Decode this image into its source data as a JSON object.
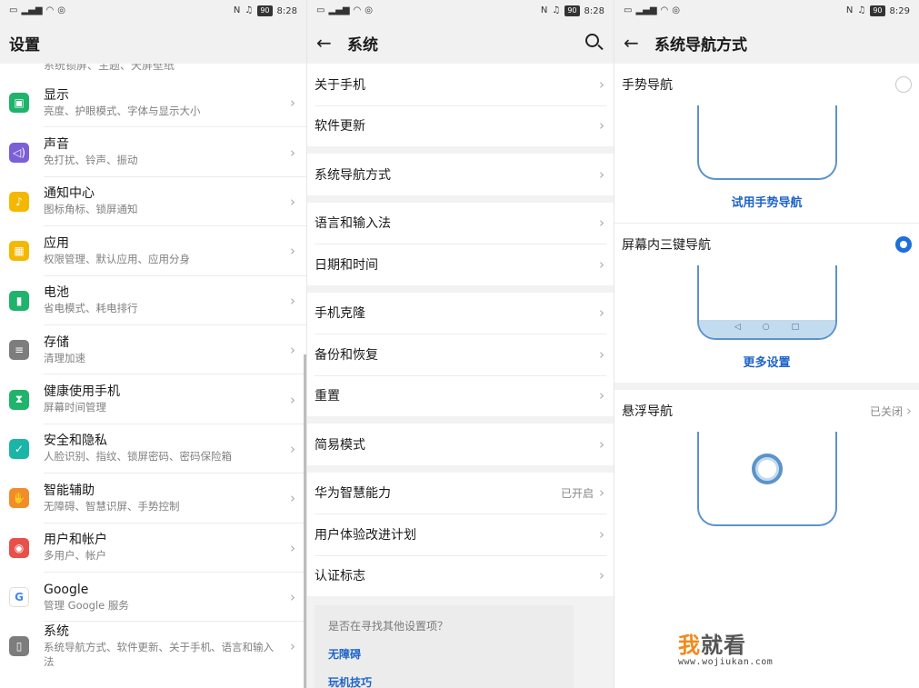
{
  "colors": {
    "accent": "#1e6fd9",
    "link": "#1e64c8",
    "nav_blue": "#5b93cb",
    "nav_light": "#c3dbef",
    "watermark_orange": "#f08a1c"
  },
  "status": {
    "left_icons": [
      "sim-icon",
      "signal-icon",
      "wifi-icon",
      "sync-icon"
    ],
    "nfc": "N",
    "mute": "♪̸",
    "battery": "90",
    "time_p1": "8:28",
    "time_p2": "8:28",
    "time_p3": "8:29"
  },
  "panel1": {
    "title": "设置",
    "clipped_text": "系统锁屏、主题、天屏壁纸",
    "items": [
      {
        "icon": "display-icon",
        "color": "#1fb36b",
        "title": "显示",
        "subtitle": "亮度、护眼模式、字体与显示大小"
      },
      {
        "icon": "sound-icon",
        "color": "#7b5fd6",
        "title": "声音",
        "subtitle": "免打扰、铃声、振动"
      },
      {
        "icon": "bell-icon",
        "color": "#f5b800",
        "title": "通知中心",
        "subtitle": "图标角标、锁屏通知"
      },
      {
        "icon": "apps-icon",
        "color": "#f5b800",
        "title": "应用",
        "subtitle": "权限管理、默认应用、应用分身"
      },
      {
        "icon": "battery-icon",
        "color": "#1fb36b",
        "title": "电池",
        "subtitle": "省电模式、耗电排行"
      },
      {
        "icon": "storage-icon",
        "color": "#7d7d7d",
        "title": "存储",
        "subtitle": "清理加速"
      },
      {
        "icon": "hourglass-icon",
        "color": "#1fb36b",
        "title": "健康使用手机",
        "subtitle": "屏幕时间管理"
      },
      {
        "icon": "shield-icon",
        "color": "#1bb5a8",
        "title": "安全和隐私",
        "subtitle": "人脸识别、指纹、锁屏密码、密码保险箱"
      },
      {
        "icon": "hand-icon",
        "color": "#f28c28",
        "title": "智能辅助",
        "subtitle": "无障碍、智慧识屏、手势控制"
      },
      {
        "icon": "user-icon",
        "color": "#e8504a",
        "title": "用户和帐户",
        "subtitle": "多用户、帐户"
      },
      {
        "icon": "google-icon",
        "color": "#ffffff",
        "title": "Google",
        "subtitle": "管理 Google 服务"
      },
      {
        "icon": "system-icon",
        "color": "#7d7d7d",
        "title": "系统",
        "subtitle": "系统导航方式、软件更新、关于手机、语言和输入法"
      }
    ]
  },
  "panel2": {
    "title": "系统",
    "groups": [
      [
        {
          "label": "关于手机"
        },
        {
          "label": "软件更新"
        }
      ],
      [
        {
          "label": "系统导航方式"
        }
      ],
      [
        {
          "label": "语言和输入法"
        },
        {
          "label": "日期和时间"
        }
      ],
      [
        {
          "label": "手机克隆"
        },
        {
          "label": "备份和恢复"
        },
        {
          "label": "重置"
        }
      ],
      [
        {
          "label": "简易模式"
        }
      ],
      [
        {
          "label": "华为智慧能力",
          "value": "已开启"
        },
        {
          "label": "用户体验改进计划"
        },
        {
          "label": "认证标志"
        }
      ]
    ],
    "suggest_question": "是否在寻找其他设置项？",
    "suggest_links": [
      "无障碍",
      "玩机技巧"
    ]
  },
  "panel3": {
    "title": "系统导航方式",
    "gesture_label": "手势导航",
    "gesture_try": "试用手势导航",
    "three_key_label": "屏幕内三键导航",
    "three_key_selected": true,
    "nav_buttons": [
      "◁",
      "○",
      "□"
    ],
    "more_settings": "更多设置",
    "float_label": "悬浮导航",
    "float_value": "已关闭"
  },
  "watermark": {
    "part1": "我",
    "part2": "就看",
    "url": "www.wojiukan.com"
  }
}
